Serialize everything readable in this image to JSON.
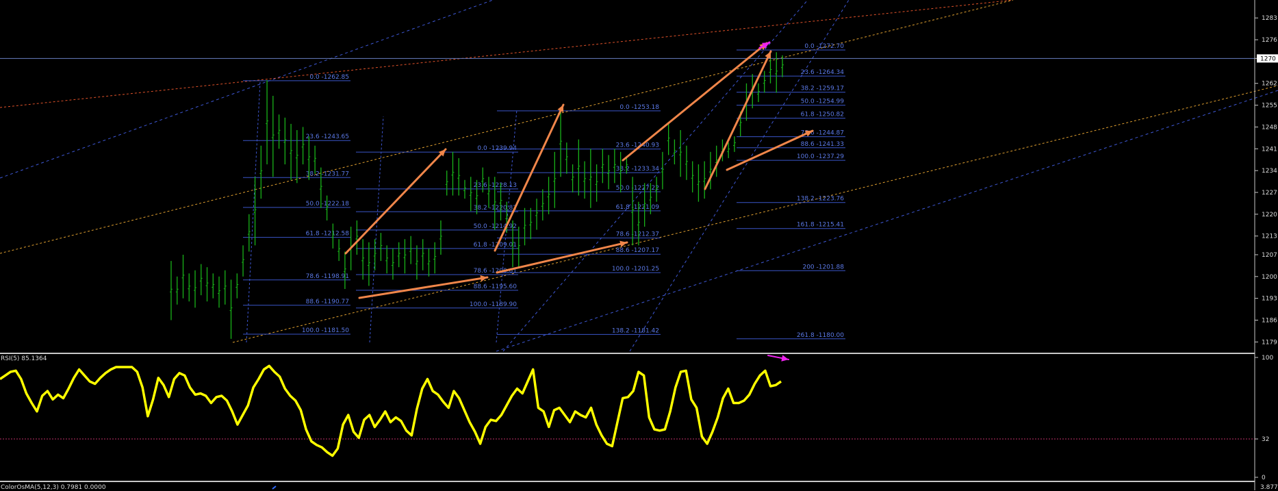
{
  "chart_data": [
    {
      "type": "candlestick",
      "panel": "price",
      "ylim": [
        1176,
        1287
      ],
      "y_ticks": [
        "1283",
        "1276",
        "1270",
        "1262",
        "1255",
        "1248",
        "1241",
        "1234",
        "1227",
        "1220",
        "1213",
        "1207",
        "1200",
        "1193",
        "1186",
        "1179"
      ],
      "current_price": "1270",
      "price_line": 1270,
      "colors": {
        "bars": "#19b319",
        "fib": "#3a55c8",
        "fib_text": "#5b79e6",
        "arrow": "#f0864a",
        "magenta": "#ee22ee",
        "grid_line": "#6a7fc0"
      },
      "bars": [
        [
          1186,
          1205
        ],
        [
          1191,
          1200
        ],
        [
          1193,
          1207
        ],
        [
          1192,
          1201
        ],
        [
          1190,
          1202
        ],
        [
          1194,
          1204
        ],
        [
          1192,
          1203
        ],
        [
          1193,
          1201
        ],
        [
          1190,
          1200
        ],
        [
          1191,
          1202
        ],
        [
          1180,
          1199
        ],
        [
          1193,
          1201
        ],
        [
          1200,
          1210
        ],
        [
          1208,
          1220
        ],
        [
          1210,
          1232
        ],
        [
          1225,
          1242
        ],
        [
          1236,
          1263
        ],
        [
          1232,
          1258
        ],
        [
          1241,
          1252
        ],
        [
          1236,
          1251
        ],
        [
          1231,
          1249
        ],
        [
          1230,
          1247
        ],
        [
          1236,
          1248
        ],
        [
          1231,
          1245
        ],
        [
          1233,
          1242
        ],
        [
          1222,
          1235
        ],
        [
          1218,
          1226
        ],
        [
          1209,
          1217
        ],
        [
          1205,
          1212
        ],
        [
          1196,
          1208
        ],
        [
          1202,
          1216
        ],
        [
          1207,
          1218
        ],
        [
          1199,
          1212
        ],
        [
          1197,
          1211
        ],
        [
          1202,
          1212
        ],
        [
          1205,
          1214
        ],
        [
          1201,
          1210
        ],
        [
          1199,
          1209
        ],
        [
          1203,
          1211
        ],
        [
          1201,
          1212
        ],
        [
          1204,
          1213
        ],
        [
          1199,
          1210
        ],
        [
          1202,
          1212
        ],
        [
          1200,
          1209
        ],
        [
          1201,
          1211
        ],
        [
          1207,
          1218
        ],
        [
          1226,
          1234
        ],
        [
          1226,
          1240
        ],
        [
          1226,
          1238
        ],
        [
          1225,
          1231
        ],
        [
          1221,
          1232
        ],
        [
          1220,
          1231
        ],
        [
          1227,
          1235
        ],
        [
          1222,
          1232
        ],
        [
          1215,
          1232
        ],
        [
          1218,
          1230
        ],
        [
          1214,
          1224
        ],
        [
          1203,
          1218
        ],
        [
          1203,
          1216
        ],
        [
          1210,
          1222
        ],
        [
          1212,
          1222
        ],
        [
          1215,
          1225
        ],
        [
          1218,
          1228
        ],
        [
          1220,
          1232
        ],
        [
          1222,
          1240
        ],
        [
          1232,
          1254
        ],
        [
          1233,
          1243
        ],
        [
          1227,
          1236
        ],
        [
          1226,
          1244
        ],
        [
          1225,
          1237
        ],
        [
          1222,
          1241
        ],
        [
          1224,
          1236
        ],
        [
          1230,
          1241
        ],
        [
          1228,
          1239
        ],
        [
          1230,
          1241
        ],
        [
          1227,
          1240
        ],
        [
          1233,
          1238
        ],
        [
          1210,
          1232
        ],
        [
          1210,
          1224
        ],
        [
          1216,
          1230
        ],
        [
          1220,
          1230
        ],
        [
          1224,
          1232
        ],
        [
          1228,
          1240
        ],
        [
          1239,
          1249
        ],
        [
          1236,
          1244
        ],
        [
          1232,
          1247
        ],
        [
          1231,
          1242
        ],
        [
          1227,
          1237
        ],
        [
          1224,
          1236
        ],
        [
          1225,
          1237
        ],
        [
          1228,
          1240
        ],
        [
          1232,
          1242
        ],
        [
          1237,
          1244
        ],
        [
          1238,
          1243
        ],
        [
          1240,
          1245
        ],
        [
          1245,
          1253
        ],
        [
          1250,
          1262
        ],
        [
          1254,
          1265
        ],
        [
          1256,
          1262
        ],
        [
          1259,
          1266
        ],
        [
          1262,
          1270
        ],
        [
          1259,
          1272
        ],
        [
          1264,
          1271
        ]
      ],
      "fib_sets": [
        {
          "levels": [
            [
              "0.0",
              "1262.85"
            ],
            [
              "23.6",
              "1243.65"
            ],
            [
              "38.2",
              "1231.77"
            ],
            [
              "50.0",
              "1222.18"
            ],
            [
              "61.8",
              "1212.58"
            ],
            [
              "78.6",
              "1198.91"
            ],
            [
              "88.6",
              "1190.77"
            ],
            [
              "100.0",
              "1181.50"
            ]
          ]
        },
        {
          "levels": [
            [
              "0.0",
              "1239.94"
            ],
            [
              "23.6",
              "1228.13"
            ],
            [
              "38.2",
              "1220.82"
            ],
            [
              "50.0",
              "1214.92"
            ],
            [
              "61.8",
              "1209.01"
            ],
            [
              "78.6",
              "1200.61"
            ],
            [
              "88.6",
              "1195.60"
            ],
            [
              "100.0",
              "1189.90"
            ]
          ]
        },
        {
          "levels": [
            [
              "0.0",
              "1253.18"
            ],
            [
              "23.6",
              "1240.93"
            ],
            [
              "38.2",
              "1233.34"
            ],
            [
              "50.0",
              "1227.22"
            ],
            [
              "61.8",
              "1221.09"
            ],
            [
              "78.6",
              "1212.37"
            ],
            [
              "88.6",
              "1207.17"
            ],
            [
              "100.0",
              "1201.25"
            ],
            [
              "138.2",
              "1181.42"
            ]
          ]
        },
        {
          "levels": [
            [
              "0.0",
              "1272.70"
            ],
            [
              "23.6",
              "1264.34"
            ],
            [
              "38.2",
              "1259.17"
            ],
            [
              "50.0",
              "1254.99"
            ],
            [
              "61.8",
              "1250.82"
            ],
            [
              "78.6",
              "1244.87"
            ],
            [
              "88.6",
              "1241.33"
            ],
            [
              "100.0",
              "1237.29"
            ],
            [
              "138.2",
              "1223.76"
            ],
            [
              "161.8",
              "1215.41"
            ],
            [
              "200",
              "1201.88"
            ],
            [
              "261.8",
              "1180.00"
            ]
          ]
        }
      ]
    },
    {
      "type": "line",
      "panel": "RSI",
      "title": "RSI(5) 85.1364",
      "ylim": [
        0,
        100
      ],
      "y_ticks": [
        "100",
        "32",
        "0"
      ],
      "level": 32,
      "color": "#ffff00",
      "values": [
        82,
        85,
        88,
        89,
        82,
        70,
        62,
        55,
        68,
        72,
        65,
        69,
        66,
        74,
        83,
        90,
        85,
        80,
        78,
        83,
        87,
        90,
        92,
        92,
        92,
        92,
        88,
        75,
        51,
        65,
        83,
        77,
        67,
        82,
        87,
        85,
        75,
        69,
        70,
        68,
        62,
        67,
        68,
        64,
        55,
        44,
        52,
        60,
        75,
        82,
        90,
        93,
        88,
        84,
        74,
        68,
        64,
        56,
        40,
        30,
        27,
        25,
        21,
        18,
        24,
        44,
        52,
        38,
        33,
        48,
        52,
        42,
        48,
        55,
        46,
        50,
        47,
        39,
        35,
        57,
        74,
        82,
        72,
        69,
        63,
        58,
        72,
        66,
        56,
        46,
        38,
        28,
        42,
        48,
        47,
        52,
        60,
        68,
        74,
        70,
        80,
        90,
        58,
        55,
        42,
        56,
        58,
        52,
        46,
        55,
        52,
        50,
        58,
        44,
        35,
        28,
        26,
        46,
        66,
        67,
        72,
        88,
        85,
        50,
        40,
        39,
        40,
        55,
        75,
        88,
        89,
        65,
        58,
        34,
        28,
        38,
        50,
        66,
        74,
        62,
        62,
        64,
        69,
        78,
        85,
        89,
        76,
        77,
        80
      ]
    },
    {
      "type": "histogram",
      "panel": "ColorOsMA",
      "title": "ColorOsMA(5,12,3) 0.7981 0.0000",
      "y_top_tick": "3.877"
    }
  ]
}
